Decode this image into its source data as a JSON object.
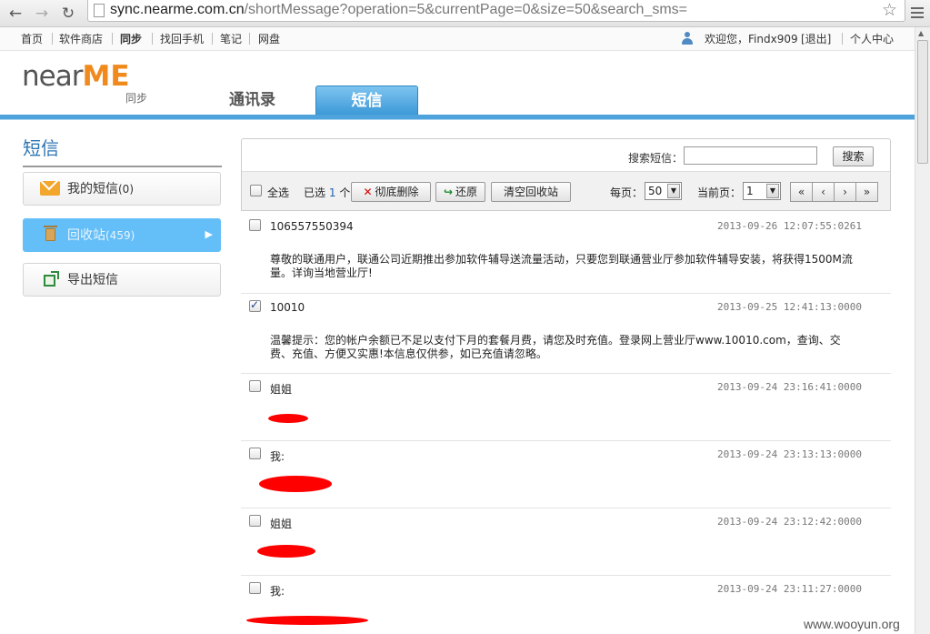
{
  "browser": {
    "url_host": "sync.nearme.com.cn",
    "url_path": "/shortMessage?operation=5&currentPage=0&size=50&search_sms="
  },
  "top_nav": {
    "links": [
      "首页",
      "软件商店",
      "同步",
      "找回手机",
      "笔记",
      "网盘"
    ],
    "welcome": "欢迎您，Findx909",
    "logout": "[退出]",
    "personal_center": "个人中心"
  },
  "logo": {
    "near": "near",
    "me": "ME",
    "sub": "同步"
  },
  "tabs": {
    "contacts": "通讯录",
    "sms": "短信"
  },
  "sidebar": {
    "title": "短信",
    "items": [
      {
        "label": "我的短信",
        "count": "(0)"
      },
      {
        "label": "回收站",
        "count": "(459)"
      },
      {
        "label": "导出短信",
        "count": ""
      }
    ]
  },
  "toolbar": {
    "search_label": "搜索短信：",
    "search_value": "",
    "search_button": "搜索",
    "select_all": "全选",
    "selected_prefix": "已选",
    "selected_count": "1",
    "selected_suffix": "个",
    "delete_button": "彻底删除",
    "restore_button": "还原",
    "empty_button": "清空回收站",
    "per_page_label": "每页：",
    "per_page_value": "50",
    "current_page_label": "当前页：",
    "current_page_value": "1"
  },
  "messages": [
    {
      "from": "106557550394",
      "time": "2013-09-26 12:07:55:0261",
      "body": "尊敬的联通用户，联通公司近期推出参加软件辅导送流量活动，只要您到联通营业厅参加软件辅导安装，将获得1500M流量。详询当地营业厅!",
      "checked": false
    },
    {
      "from": "10010",
      "time": "2013-09-25 12:41:13:0000",
      "body": "温馨提示：您的帐户余额已不足以支付下月的套餐月费，请您及时充值。登录网上营业厅www.10010.com，查询、交费、充值、方便又实惠!本信息仅供参，如已充值请忽略。",
      "checked": true
    },
    {
      "from": "姐姐",
      "time": "2013-09-24 23:16:41:0000",
      "body": "",
      "checked": false
    },
    {
      "from": "我:",
      "time": "2013-09-24 23:13:13:0000",
      "body": "",
      "checked": false
    },
    {
      "from": "姐姐",
      "time": "2013-09-24 23:12:42:0000",
      "body": "",
      "checked": false
    },
    {
      "from": "我:",
      "time": "2013-09-24 23:11:27:0000",
      "body": "",
      "checked": false
    }
  ],
  "watermark": "www.wooyun.org"
}
